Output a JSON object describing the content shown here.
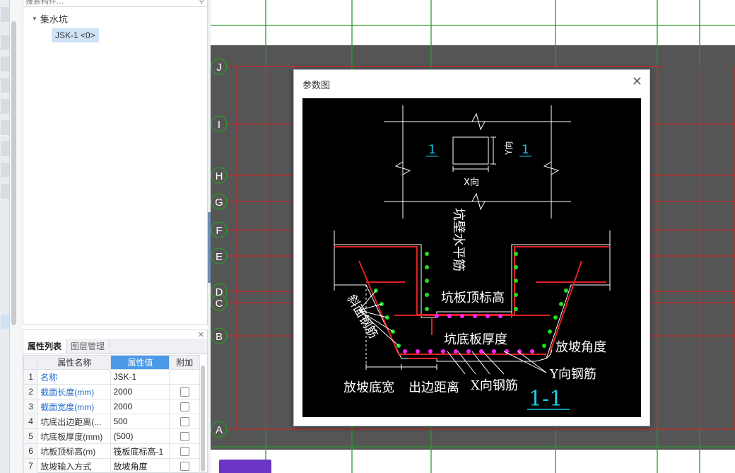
{
  "tree": {
    "search_placeholder": "搜索构件...",
    "root_label": "集水坑",
    "item_label": "JSK-1 <0>"
  },
  "properties": {
    "tabs": [
      "属性列表",
      "图层管理"
    ],
    "headers": {
      "name": "属性名称",
      "value": "属性值",
      "extra": "附加"
    },
    "rows": [
      {
        "no": "1",
        "name": "名称",
        "value": "JSK-1"
      },
      {
        "no": "2",
        "name": "截面长度(mm)",
        "value": "2000"
      },
      {
        "no": "3",
        "name": "截面宽度(mm)",
        "value": "2000"
      },
      {
        "no": "4",
        "name": "坑底出边距离(...",
        "value": "500"
      },
      {
        "no": "5",
        "name": "坑底板厚度(mm)",
        "value": "(500)"
      },
      {
        "no": "6",
        "name": "坑板顶标高(m)",
        "value": "筏板底标高-1"
      },
      {
        "no": "7",
        "name": "放坡输入方式",
        "value": "放坡角度"
      }
    ]
  },
  "axes": {
    "labels": [
      "J",
      "I",
      "H",
      "G",
      "F",
      "E",
      "D",
      "C",
      "B",
      "A"
    ]
  },
  "dialog": {
    "title": "参数图",
    "diagram": {
      "section_mark": "1",
      "x_dir": "X向",
      "y_dir": "Y向",
      "wall_rebar": "坑壁水平筋",
      "slab_top_elev": "坑板顶标高",
      "slope_rebar": "斜面钢筋",
      "slab_thickness": "坑底板厚度",
      "slope_angle": "放坡角度",
      "y_rebar": "Y向钢筋",
      "slope_width": "放坡底宽",
      "edge_distance": "出边距离",
      "x_rebar": "X向钢筋",
      "section_title": "1-1"
    }
  },
  "colors": {
    "grid_red": "#e02020",
    "grid_green": "#2a9a2a",
    "canvas_dark": "#555555",
    "accent_blue": "#4a9ae8"
  }
}
